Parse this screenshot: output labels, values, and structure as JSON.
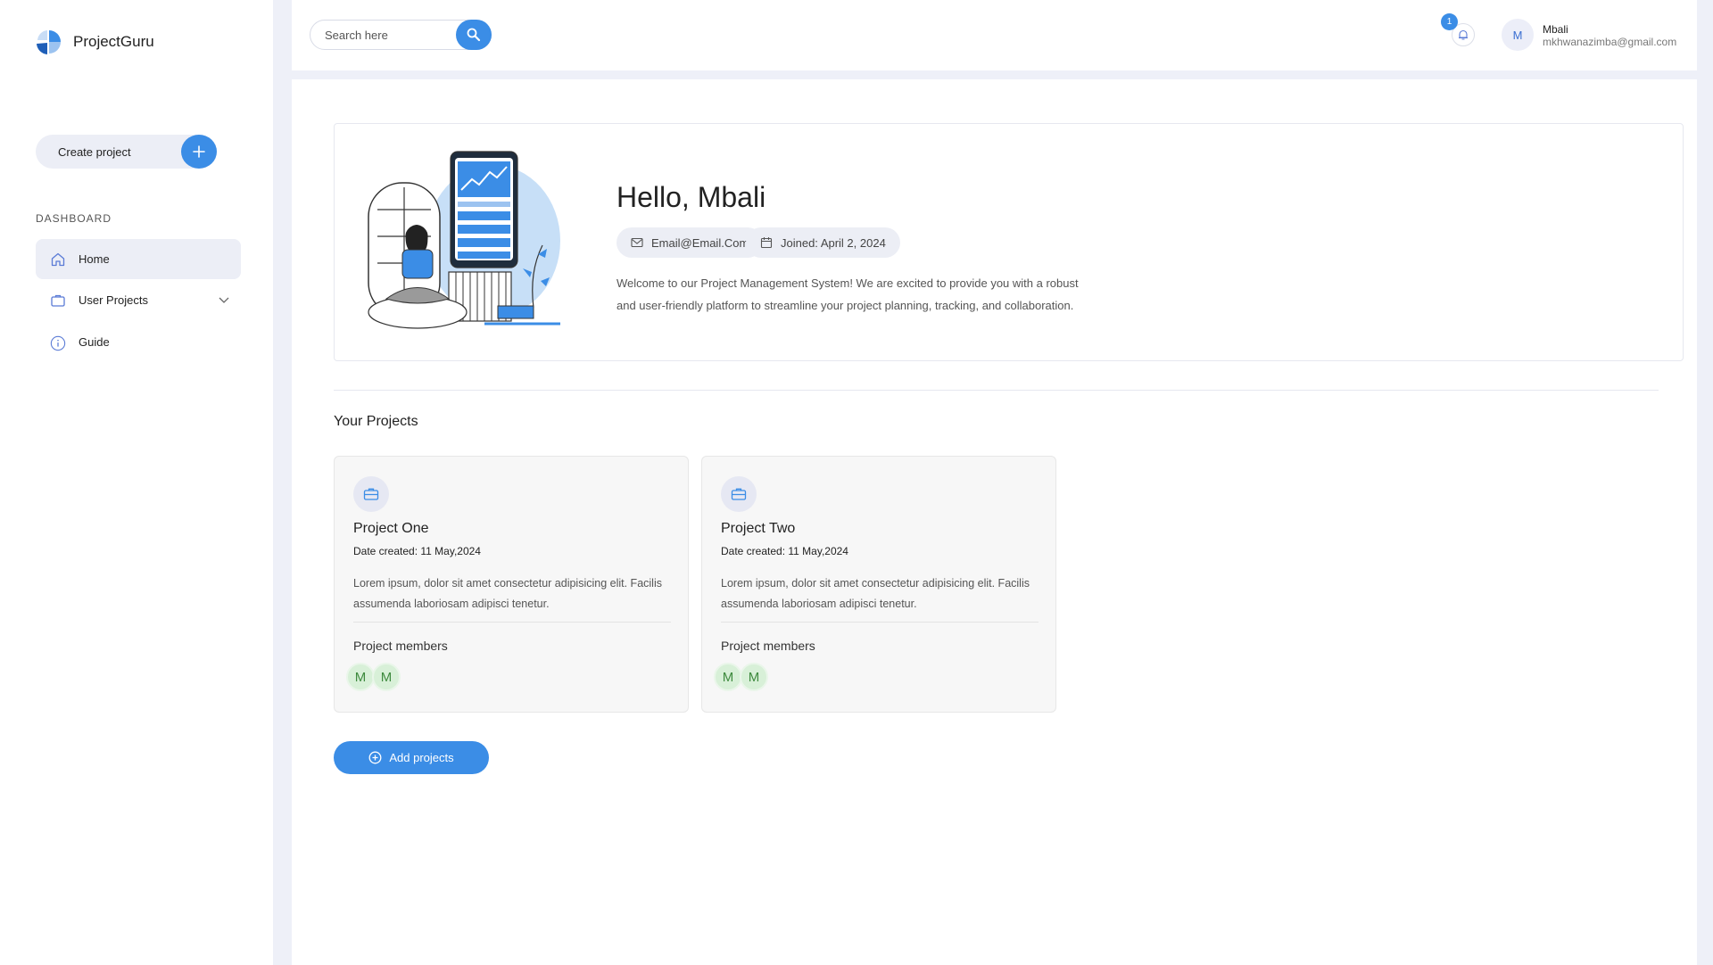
{
  "app": {
    "name": "ProjectGuru",
    "accent": "#3b8de6"
  },
  "sidebar": {
    "create_label": "Create project",
    "section_label": "DASHBOARD",
    "items": [
      {
        "label": "Home",
        "icon": "home-icon",
        "active": true
      },
      {
        "label": "User Projects",
        "icon": "briefcase-icon",
        "active": false
      },
      {
        "label": "Guide",
        "icon": "info-icon",
        "active": false
      }
    ]
  },
  "topbar": {
    "search_placeholder": "Search here",
    "notification_count": "1",
    "user": {
      "initial": "M",
      "name": "Mbali",
      "email": "mkhwanazimba@gmail.com"
    }
  },
  "hero": {
    "greeting": "Hello, Mbali",
    "email": "Email@Email.Com",
    "joined": "Joined: April 2, 2024",
    "welcome": "Welcome to our Project Management System! We are excited to provide you with a robust and user-friendly platform to streamline your project planning, tracking, and collaboration."
  },
  "projects": {
    "title": "Your Projects",
    "items": [
      {
        "name": "Project One",
        "date": "Date created: 11 May,2024",
        "description": "Lorem ipsum, dolor sit amet consectetur adipisicing elit. Facilis assumenda laboriosam adipisci tenetur.",
        "members_label": "Project members",
        "members": [
          "M",
          "M"
        ]
      },
      {
        "name": "Project Two",
        "date": "Date created: 11 May,2024",
        "description": "Lorem ipsum, dolor sit amet consectetur adipisicing elit. Facilis assumenda laboriosam adipisci tenetur.",
        "members_label": "Project members",
        "members": [
          "M",
          "M"
        ]
      }
    ],
    "add_label": "Add projects"
  }
}
